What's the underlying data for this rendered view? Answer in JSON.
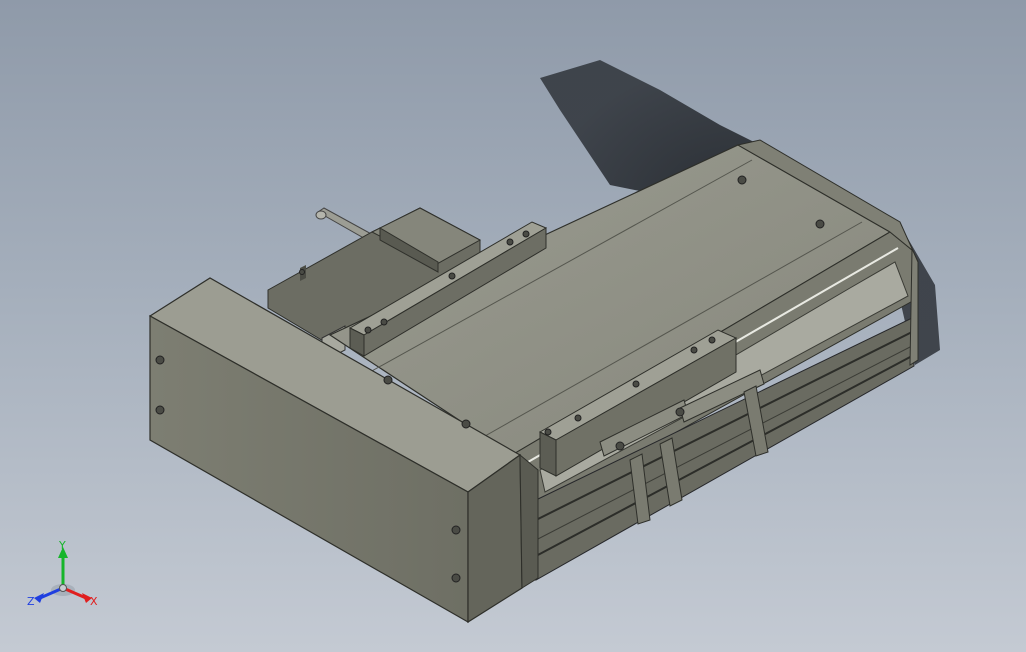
{
  "viewport": {
    "background_top": "#8f9aa9",
    "background_bottom": "#c4cad3"
  },
  "model": {
    "name": "",
    "body_color": "#8a8b80",
    "top_color": "#8f9085",
    "dark_color": "#56574f",
    "shadow_color": "#2b2f35"
  },
  "triad": {
    "x_label": "X",
    "y_label": "Y",
    "z_label": "Z",
    "x_color": "#e01f1f",
    "y_color": "#16b52a",
    "z_color": "#1f3fe0"
  }
}
